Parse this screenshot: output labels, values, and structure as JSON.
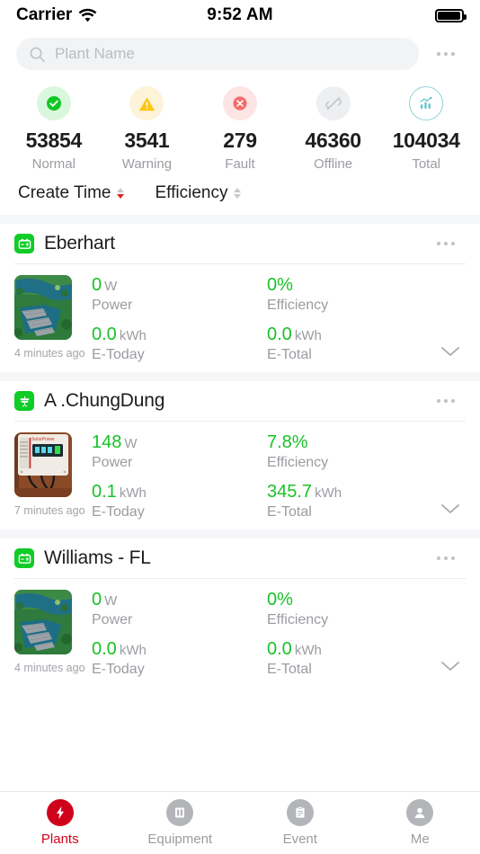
{
  "status_bar": {
    "carrier": "Carrier",
    "time": "9:52 AM",
    "wifi_icon": "wifi-icon",
    "battery_icon": "battery-icon"
  },
  "search": {
    "placeholder": "Plant Name",
    "value": "",
    "icon": "search-icon",
    "overflow_icon": "more-options-icon"
  },
  "stats": [
    {
      "value": "53854",
      "label": "Normal",
      "icon": "check-circle-icon",
      "icon_color": "#11c722",
      "bg": "#d9f7dd"
    },
    {
      "value": "3541",
      "label": "Warning",
      "icon": "warning-triangle-icon",
      "icon_color": "#ffc40c",
      "bg": "#fdf3d8"
    },
    {
      "value": "279",
      "label": "Fault",
      "icon": "error-circle-icon",
      "icon_color": "#f46e6e",
      "bg": "#fde5e5"
    },
    {
      "value": "46360",
      "label": "Offline",
      "icon": "disconnected-icon",
      "icon_color": "#c3c5c9",
      "bg": "#eeeff1"
    },
    {
      "value": "104034",
      "label": "Total",
      "icon": "bar-chart-icon",
      "icon_color": "#62c4cc",
      "bg": "#ffffff"
    }
  ],
  "sort": {
    "create_time": {
      "label": "Create Time",
      "direction": "desc",
      "active": true
    },
    "efficiency": {
      "label": "Efficiency",
      "direction": "none",
      "active": false
    }
  },
  "plants": [
    {
      "name": "Eberhart",
      "status_icon": "inverter-green-icon",
      "overflow_icon": "more-options-icon",
      "thumbnail": "floating-solar-farm-photo",
      "updated": "4 minutes ago",
      "expand_icon": "chevron-down-icon",
      "metrics": [
        {
          "value": "0",
          "unit": "W",
          "label": "Power"
        },
        {
          "value": "0%",
          "unit": "",
          "label": "Efficiency"
        },
        {
          "value": "0.0",
          "unit": "kWh",
          "label": "E-Today"
        },
        {
          "value": "0.0",
          "unit": "kWh",
          "label": "E-Total"
        }
      ]
    },
    {
      "name": "A .ChungDung",
      "status_icon": "solar-tower-green-icon",
      "overflow_icon": "more-options-icon",
      "thumbnail": "wall-mounted-inverter-photo",
      "updated": "7 minutes ago",
      "expand_icon": "chevron-down-icon",
      "metrics": [
        {
          "value": "148",
          "unit": "W",
          "label": "Power"
        },
        {
          "value": "7.8%",
          "unit": "",
          "label": "Efficiency"
        },
        {
          "value": "0.1",
          "unit": "kWh",
          "label": "E-Today"
        },
        {
          "value": "345.7",
          "unit": "kWh",
          "label": "E-Total"
        }
      ]
    },
    {
      "name": "Williams - FL",
      "status_icon": "inverter-green-icon",
      "overflow_icon": "more-options-icon",
      "thumbnail": "floating-solar-farm-photo",
      "updated": "4 minutes ago",
      "expand_icon": "chevron-down-icon",
      "metrics": [
        {
          "value": "0",
          "unit": "W",
          "label": "Power"
        },
        {
          "value": "0%",
          "unit": "",
          "label": "Efficiency"
        },
        {
          "value": "0.0",
          "unit": "kWh",
          "label": "E-Today"
        },
        {
          "value": "0.0",
          "unit": "kWh",
          "label": "E-Total"
        }
      ]
    }
  ],
  "tabs": [
    {
      "label": "Plants",
      "icon": "lightning-bolt-icon",
      "active": true
    },
    {
      "label": "Equipment",
      "icon": "device-icon",
      "active": false
    },
    {
      "label": "Event",
      "icon": "clipboard-icon",
      "active": false
    },
    {
      "label": "Me",
      "icon": "person-icon",
      "active": false
    }
  ],
  "colors": {
    "accent_red": "#d0021b",
    "value_green": "#17c227",
    "muted": "#9a9ca1",
    "panel_bg": "#f5f6f8"
  }
}
